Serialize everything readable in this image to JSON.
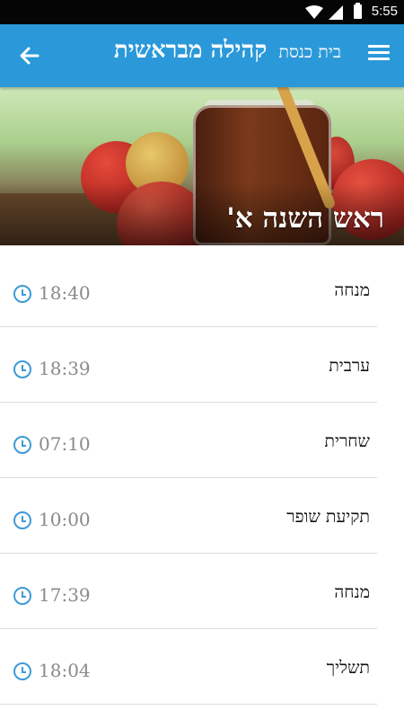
{
  "status_bar": {
    "time": "5:55"
  },
  "app_bar": {
    "subtitle": "בית כנסת",
    "title": "קהילה מבראשית"
  },
  "hero": {
    "title": "ראש השנה א'"
  },
  "schedule": [
    {
      "name": "מנחה",
      "time": "18:40"
    },
    {
      "name": "ערבית",
      "time": "18:39"
    },
    {
      "name": "שחרית",
      "time": "07:10"
    },
    {
      "name": "תקיעת שופר",
      "time": "10:00"
    },
    {
      "name": "מנחה",
      "time": "17:39"
    },
    {
      "name": "תשליך",
      "time": "18:04"
    }
  ],
  "colors": {
    "app_bar": "#2b99d9",
    "clock_icon": "#3f9ad6"
  }
}
